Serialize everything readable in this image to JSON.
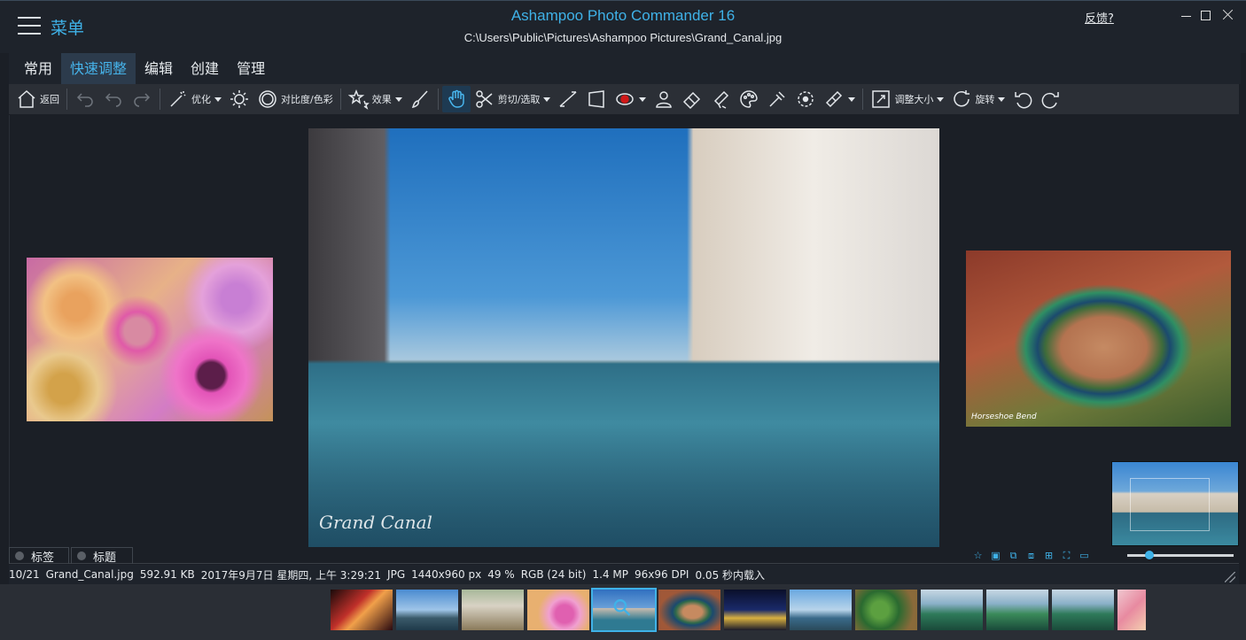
{
  "titlebar": {
    "menu_label": "菜单",
    "app_title": "Ashampoo Photo Commander 16",
    "file_path": "C:\\Users\\Public\\Pictures\\Ashampoo Pictures\\Grand_Canal.jpg",
    "feedback": "反馈?"
  },
  "tabs": [
    {
      "label": "常用"
    },
    {
      "label": "快速调整",
      "active": true
    },
    {
      "label": "编辑"
    },
    {
      "label": "创建"
    },
    {
      "label": "管理"
    }
  ],
  "toolbar": {
    "back": "返回",
    "optimize": "优化",
    "contrast": "对比度/色彩",
    "effects": "效果",
    "crop": "剪切/选取",
    "resize": "调整大小",
    "rotate": "旋转"
  },
  "image": {
    "watermark": "Grand Canal",
    "canyon_watermark": "Horseshoe Bend"
  },
  "panel_tabs": {
    "tags": "标签",
    "title": "标题"
  },
  "status": {
    "index": "10/21",
    "filename": "Grand_Canal.jpg",
    "filesize": "592.91 KB",
    "date": "2017年9月7日 星期四, 上午 3:29:21",
    "format": "JPG",
    "dimensions": "1440x960 px",
    "zoom": "49 %",
    "color": "RGB (24 bit)",
    "megapixels": "1.4 MP",
    "dpi": "96x96 DPI",
    "load_time": "0.05 秒内载入"
  },
  "colors": {
    "accent": "#3fb2e8",
    "background": "#1b1f26",
    "toolbar": "#2b2f36"
  }
}
